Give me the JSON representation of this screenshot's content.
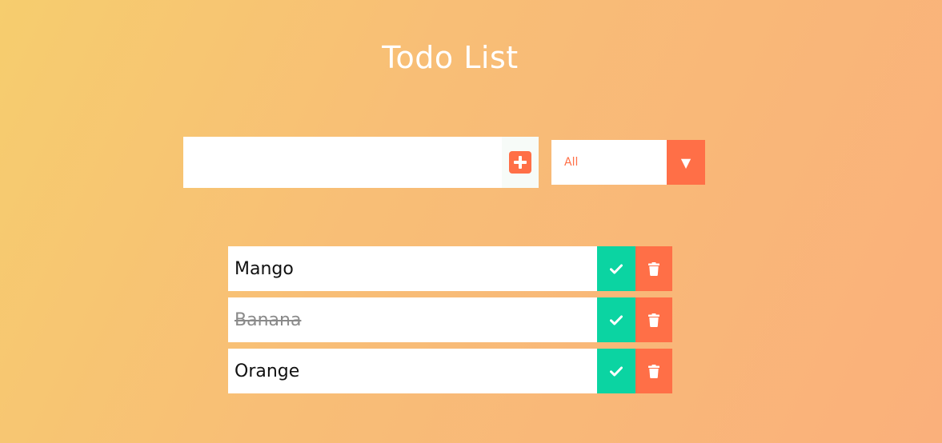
{
  "header": {
    "title": "Todo List"
  },
  "form": {
    "input_value": "",
    "input_placeholder": "",
    "add_icon": "plus-square-icon"
  },
  "filter": {
    "selected": "All",
    "arrow": "▼",
    "arrow_icon": "caret-down-icon"
  },
  "todos": [
    {
      "text": "Mango",
      "completed": false
    },
    {
      "text": "Banana",
      "completed": true
    },
    {
      "text": "Orange",
      "completed": false
    }
  ],
  "colors": {
    "accent": "#ff6f47",
    "complete": "#0bd4a2",
    "background_start": "#f6cd6e",
    "background_end": "#fab07b"
  }
}
